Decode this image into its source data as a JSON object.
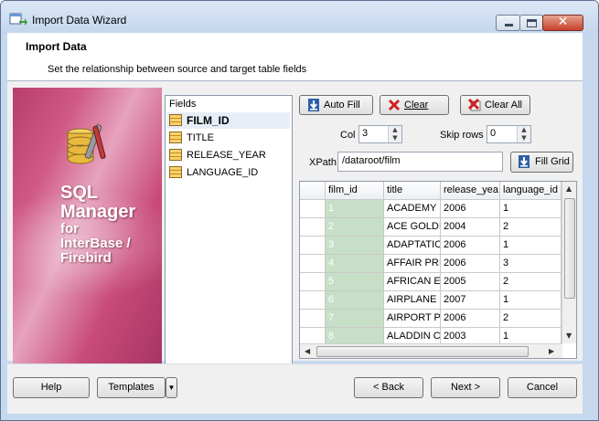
{
  "window": {
    "title": "Import Data Wizard"
  },
  "header": {
    "title": "Import Data",
    "subtitle": "Set the relationship between source and target table fields"
  },
  "banner": {
    "line1": "SQL",
    "line2": "Manager",
    "line3": "for",
    "line4": "InterBase /",
    "line5": "Firebird"
  },
  "fields": {
    "header": "Fields",
    "items": [
      {
        "label": "FILM_ID",
        "selected": true
      },
      {
        "label": "TITLE",
        "selected": false
      },
      {
        "label": "RELEASE_YEAR",
        "selected": false
      },
      {
        "label": "LANGUAGE_ID",
        "selected": false
      }
    ]
  },
  "toolbar": {
    "auto_fill": "Auto Fill",
    "clear": "Clear",
    "clear_all": "Clear All",
    "col_label": "Col",
    "col_value": "3",
    "skip_rows_label": "Skip rows",
    "skip_rows_value": "0",
    "xpath_label": "XPath",
    "xpath_value": "/dataroot/film",
    "fill_grid": "Fill Grid"
  },
  "grid": {
    "columns": [
      "film_id",
      "title",
      "release_yea",
      "language_id"
    ],
    "rows": [
      [
        "1",
        "ACADEMY D",
        "2006",
        "1"
      ],
      [
        "2",
        "ACE GOLDI",
        "2004",
        "2"
      ],
      [
        "3",
        "ADAPTATIC",
        "2006",
        "1"
      ],
      [
        "4",
        "AFFAIR PRI",
        "2006",
        "3"
      ],
      [
        "5",
        "AFRICAN E",
        "2005",
        "2"
      ],
      [
        "6",
        "AIRPLANE S",
        "2007",
        "1"
      ],
      [
        "7",
        "AIRPORT P",
        "2006",
        "2"
      ],
      [
        "8",
        "ALADDIN C.",
        "2003",
        "1"
      ]
    ]
  },
  "footer": {
    "help": "Help",
    "templates": "Templates",
    "back": "< Back",
    "next": "Next >",
    "cancel": "Cancel"
  },
  "colors": {
    "accent_banner": "#c94b79",
    "selected_column": "#c6dfc6",
    "close_button": "#c6412a"
  }
}
